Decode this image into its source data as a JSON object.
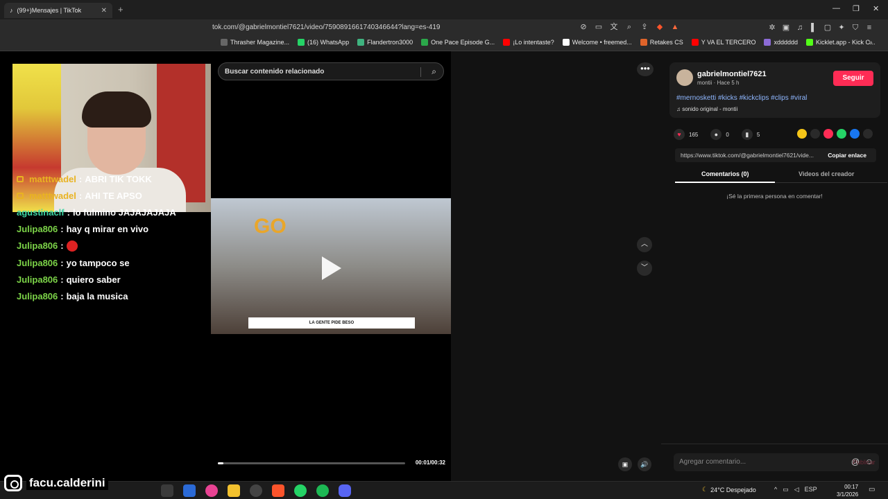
{
  "browser": {
    "tab_title": "(99+)Mensajes | TikTok",
    "url": "tok.com/@gabrielmontiel7621/video/7590891661740346644?lang=es-419",
    "bookmarks": [
      {
        "label": "Thrasher Magazine...",
        "color": "#666666"
      },
      {
        "label": "(16) WhatsApp",
        "color": "#25d366"
      },
      {
        "label": "Flandertron3000",
        "color": "#3fb37f"
      },
      {
        "label": "One Pace Episode G...",
        "color": "#2ba84a"
      },
      {
        "label": "¡Lo intentaste?",
        "color": "#ff0000"
      },
      {
        "label": "Welcome • freemed...",
        "color": "#ffffff"
      },
      {
        "label": "Retakes CS",
        "color": "#e0642a"
      },
      {
        "label": "Y VA EL TERCERO",
        "color": "#ff0000"
      },
      {
        "label": "xdddddd",
        "color": "#8c6bd6"
      },
      {
        "label": "Kicklet.app - Kick C...",
        "color": "#53fc18"
      }
    ]
  },
  "stream": {
    "chat": [
      {
        "user": "matttwadel",
        "msg": "ABRI TIK TOKK",
        "color": "#e9b321",
        "sub": true
      },
      {
        "user": "matttwadel",
        "msg": "AHI TE APSO",
        "color": "#e9b321",
        "sub": true
      },
      {
        "user": "agustinaclf",
        "msg": "lo fulmino JAJAJAJAJA",
        "color": "#3ed6a5",
        "sub": false
      },
      {
        "user": "Julipa806",
        "msg": "hay q mirar en vivo",
        "color": "#7cd348",
        "sub": false
      },
      {
        "user": "Julipa806",
        "msg": "",
        "color": "#7cd348",
        "sub": false,
        "emote": true
      },
      {
        "user": "Julipa806",
        "msg": "yo tampoco se",
        "color": "#7cd348",
        "sub": false
      },
      {
        "user": "Julipa806",
        "msg": "quiero saber",
        "color": "#7cd348",
        "sub": false
      },
      {
        "user": "Julipa806",
        "msg": "baja la musica",
        "color": "#7cd348",
        "sub": false
      }
    ],
    "instagram_handle": "facu.calderini"
  },
  "video": {
    "search_placeholder": "Buscar contenido relacionado",
    "thumbnail_caption": "LA GENTE PIDE BESO",
    "thumbnail_logo": "GO",
    "time": "00:01/00:32",
    "progress_fraction": 0.03
  },
  "post": {
    "username": "gabrielmontiel7621",
    "subline": "montii · Hace 5 h",
    "follow_label": "Seguir",
    "hashtags": "#mernosketti #kicks #kickclips #clips #viral",
    "sound": "sonido original - montii",
    "likes": "165",
    "comments": "0",
    "saves": "5",
    "link": "https://www.tiktok.com/@gabrielmontiel7621/vide...",
    "copy_label": "Copiar enlace",
    "tab_comments": "Comentarios (0)",
    "tab_creator": "Videos del creador",
    "empty_text": "¡Sé la primera persona en comentar!",
    "comment_placeholder": "Agregar comentario...",
    "publish_label": "Publicar"
  },
  "taskbar": {
    "weather": "24°C  Despejado",
    "lang": "ESP",
    "time": "00:17",
    "date": "3/1/2026"
  }
}
